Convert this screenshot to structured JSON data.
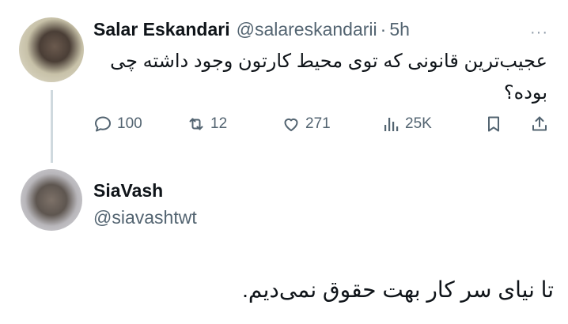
{
  "tweet": {
    "author_name": "Salar Eskandari",
    "author_handle": "@salareskandarii",
    "separator": "·",
    "time": "5h",
    "text": "عجیب‌ترین قانونی که توی محیط کارتون وجود داشته چی بوده؟",
    "more_icon": "ellipsis-icon",
    "actions": {
      "reply_count": "100",
      "retweet_count": "12",
      "like_count": "271",
      "views_count": "25K"
    }
  },
  "reply": {
    "author_name": "SiaVash",
    "author_handle": "@siavashtwt",
    "text": "تا نیای سر کار بهت حقوق نمی‌دیم."
  },
  "colors": {
    "text_primary": "#0f1419",
    "text_secondary": "#536471",
    "thread_line": "#cfd9de"
  }
}
